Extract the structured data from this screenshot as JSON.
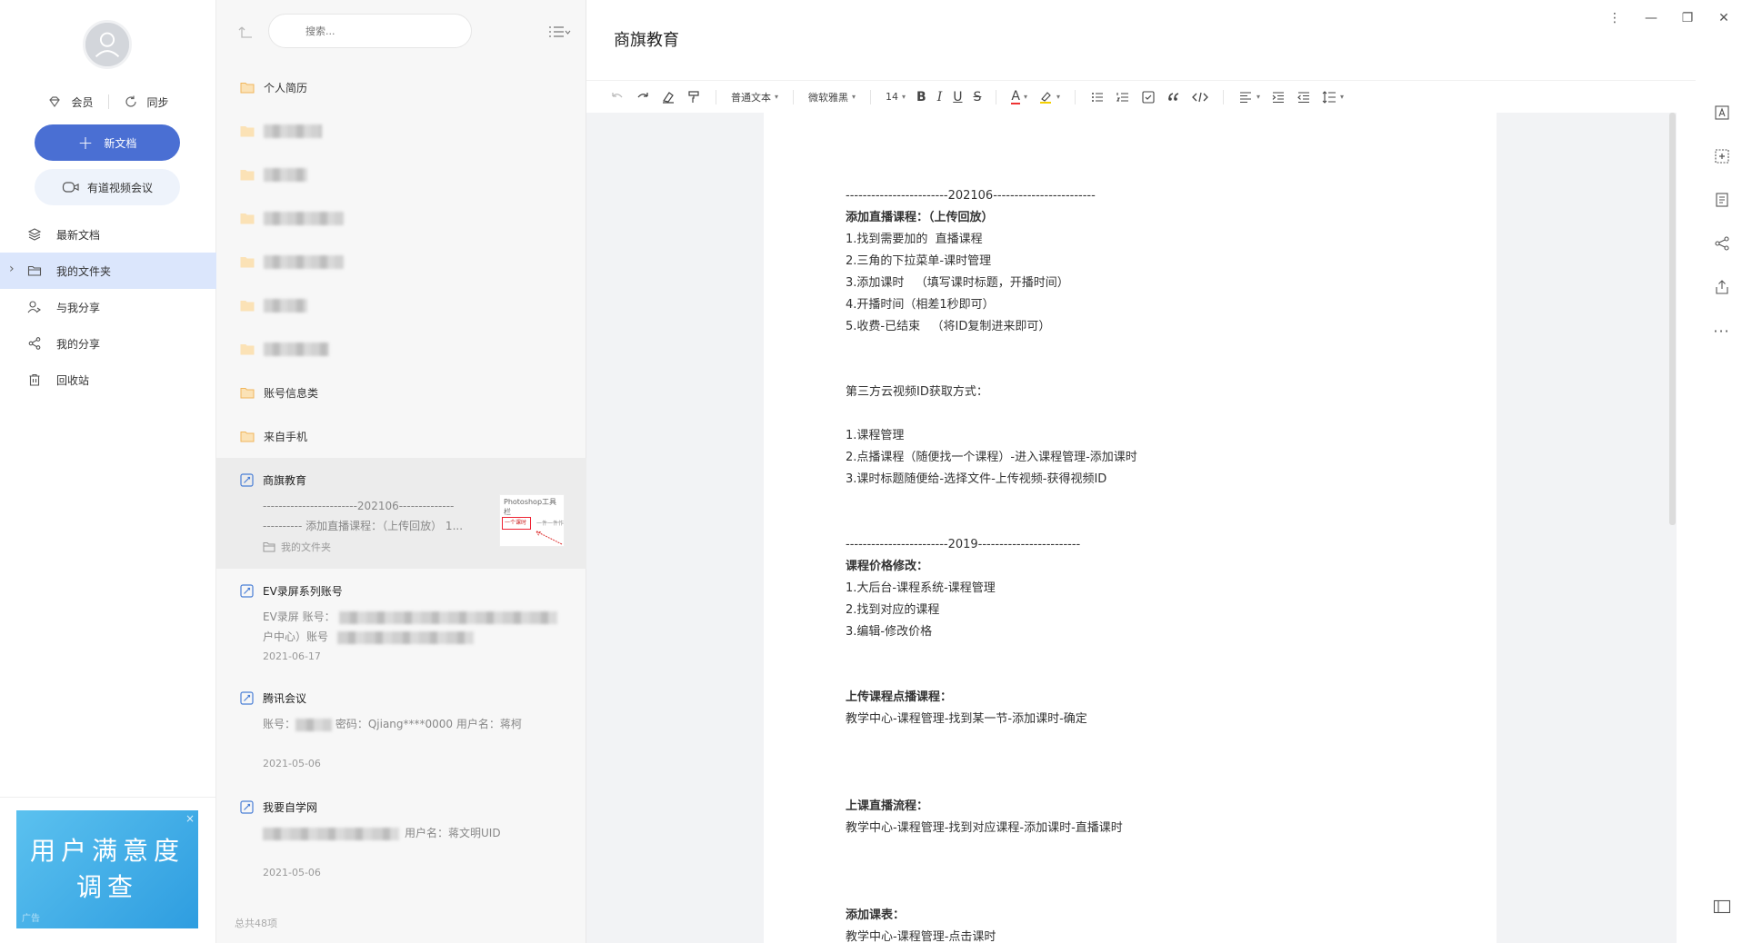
{
  "sidebar": {
    "vip_label": "会员",
    "sync_label": "同步",
    "new_doc_label": "新文档",
    "video_meeting_label": "有道视频会议",
    "nav": [
      {
        "label": "最新文档",
        "icon": "layers-icon"
      },
      {
        "label": "我的文件夹",
        "icon": "folder-outline-icon",
        "active": true
      },
      {
        "label": "与我分享",
        "icon": "user-share-icon"
      },
      {
        "label": "我的分享",
        "icon": "share-icon"
      },
      {
        "label": "回收站",
        "icon": "trash-icon"
      }
    ],
    "ad": {
      "line1": "用户满意度",
      "line2": "调查",
      "tag": "广告"
    }
  },
  "list": {
    "search_placeholder": "搜索...",
    "folders": [
      {
        "label": "个人简历"
      },
      {
        "label": "账号信息类"
      },
      {
        "label": "来自手机"
      }
    ],
    "docs": [
      {
        "title": "商旗教育",
        "preview_line1": "------------------------202106--------------",
        "preview_line2": "---------- 添加直播课程：（上传回放） 1...",
        "folder": "我的文件夹",
        "thumb_text": "Photoshop工具栏",
        "thumb_box": "一个课时",
        "thumb_text2": "一件一件作"
      },
      {
        "title": "EV录屏系列账号",
        "preview_line1_prefix": "EV录屏 账号：",
        "preview_line2_prefix": "户中心）账号",
        "date": "2021-06-17"
      },
      {
        "title": "腾讯会议",
        "preview_line1_prefix": "账号：",
        "preview_line1_suffix": " 密码：Qjiang****0000 用户名：蒋柯",
        "date": "2021-05-06"
      },
      {
        "title": "我要自学网",
        "preview_line1_suffix": "用户名：蒋文明UID",
        "date": "2021-05-06"
      }
    ],
    "footer": "总共48项"
  },
  "editor": {
    "doc_name": "商旗教育",
    "toolbar": {
      "style_select": "普通文本",
      "font_select": "微软雅黑",
      "size_select": "14",
      "bold": "B",
      "italic": "I",
      "underline": "U",
      "strike": "S",
      "font_color": "A"
    },
    "paragraphs": [
      {
        "text": "------------------------202106------------------------",
        "bold": false
      },
      {
        "text": "添加直播课程：（上传回放）",
        "bold": true
      },
      {
        "text": "1.找到需要加的  直播课程",
        "bold": false
      },
      {
        "text": "2.三角的下拉菜单-课时管理",
        "bold": false
      },
      {
        "text": "3.添加课时   （填写课时标题，开播时间）",
        "bold": false
      },
      {
        "text": "4.开播时间（相差1秒即可）",
        "bold": false
      },
      {
        "text": "5.收费-已结束   （将ID复制进来即可）",
        "bold": false
      },
      {
        "text": "",
        "bold": false
      },
      {
        "text": "",
        "bold": false
      },
      {
        "text": "第三方云视频ID获取方式：",
        "bold": false
      },
      {
        "text": "",
        "bold": false
      },
      {
        "text": "1.课程管理",
        "bold": false
      },
      {
        "text": "2.点播课程（随便找一个课程）-进入课程管理-添加课时",
        "bold": false
      },
      {
        "text": "3.课时标题随便给-选择文件-上传视频-获得视频ID",
        "bold": false
      },
      {
        "text": "",
        "bold": false
      },
      {
        "text": "",
        "bold": false
      },
      {
        "text": "------------------------2019------------------------",
        "bold": false
      },
      {
        "text": "课程价格修改：",
        "bold": true
      },
      {
        "text": "1.大后台-课程系统-课程管理",
        "bold": false
      },
      {
        "text": "2.找到对应的课程",
        "bold": false
      },
      {
        "text": "3.编辑-修改价格",
        "bold": false
      },
      {
        "text": "",
        "bold": false
      },
      {
        "text": "",
        "bold": false
      },
      {
        "text": "上传课程点播课程：",
        "bold": true
      },
      {
        "text": "教学中心-课程管理-找到某一节-添加课时-确定",
        "bold": false
      },
      {
        "text": "",
        "bold": false
      },
      {
        "text": "",
        "bold": false
      },
      {
        "text": "",
        "bold": false
      },
      {
        "text": "上课直播流程：",
        "bold": true
      },
      {
        "text": "教学中心-课程管理-找到对应课程-添加课时-直播课时",
        "bold": false
      },
      {
        "text": "",
        "bold": false
      },
      {
        "text": "",
        "bold": false
      },
      {
        "text": "",
        "bold": false
      },
      {
        "text": "添加课表：",
        "bold": true
      },
      {
        "text": "教学中心-课程管理-点击课时",
        "bold": false
      }
    ]
  },
  "colors": {
    "accent": "#4a6fd3",
    "active_bg": "#dbe6fc",
    "folder": "#f5c77e",
    "doc_icon": "#4a7fd6"
  }
}
